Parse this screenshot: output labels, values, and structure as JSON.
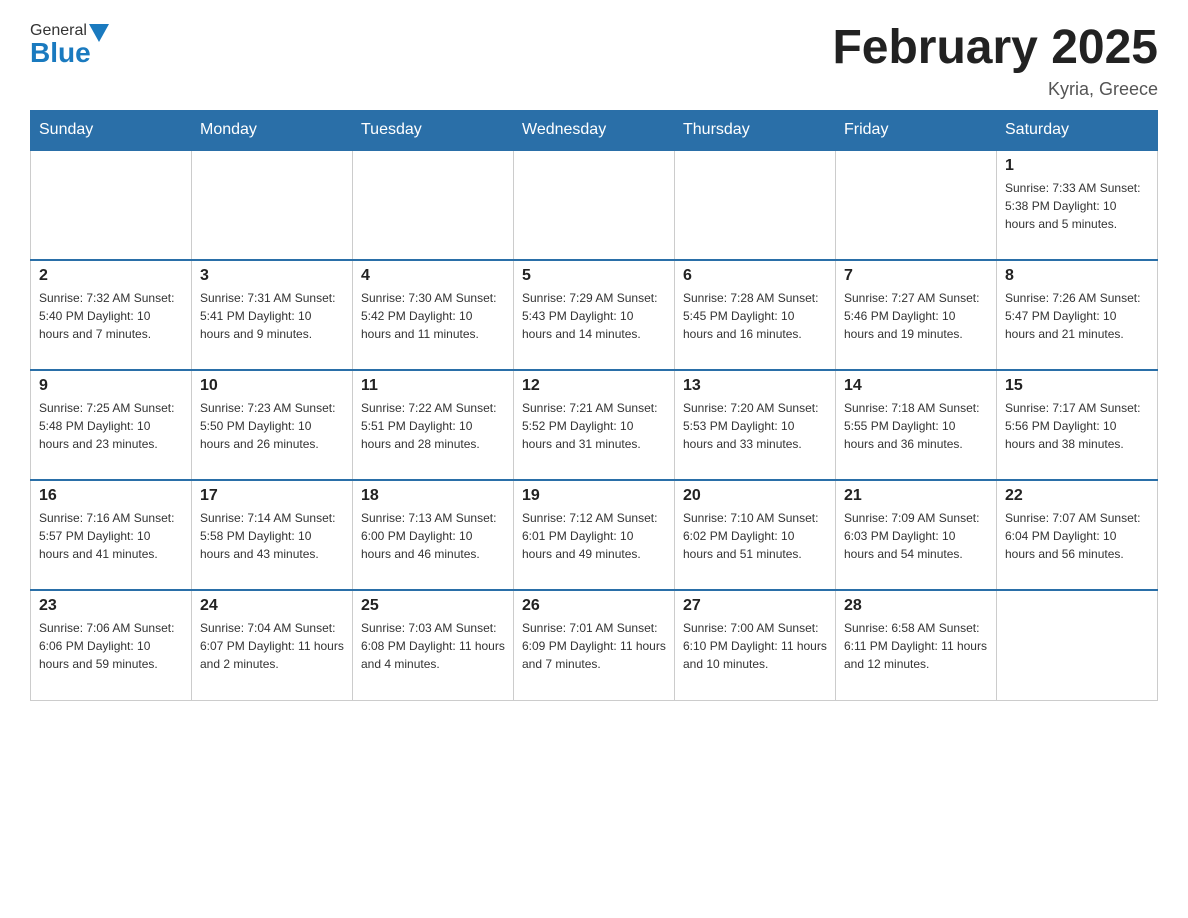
{
  "header": {
    "logo_general": "General",
    "logo_blue": "Blue",
    "month_title": "February 2025",
    "location": "Kyria, Greece"
  },
  "weekdays": [
    "Sunday",
    "Monday",
    "Tuesday",
    "Wednesday",
    "Thursday",
    "Friday",
    "Saturday"
  ],
  "weeks": [
    [
      {
        "day": "",
        "info": ""
      },
      {
        "day": "",
        "info": ""
      },
      {
        "day": "",
        "info": ""
      },
      {
        "day": "",
        "info": ""
      },
      {
        "day": "",
        "info": ""
      },
      {
        "day": "",
        "info": ""
      },
      {
        "day": "1",
        "info": "Sunrise: 7:33 AM\nSunset: 5:38 PM\nDaylight: 10 hours and 5 minutes."
      }
    ],
    [
      {
        "day": "2",
        "info": "Sunrise: 7:32 AM\nSunset: 5:40 PM\nDaylight: 10 hours and 7 minutes."
      },
      {
        "day": "3",
        "info": "Sunrise: 7:31 AM\nSunset: 5:41 PM\nDaylight: 10 hours and 9 minutes."
      },
      {
        "day": "4",
        "info": "Sunrise: 7:30 AM\nSunset: 5:42 PM\nDaylight: 10 hours and 11 minutes."
      },
      {
        "day": "5",
        "info": "Sunrise: 7:29 AM\nSunset: 5:43 PM\nDaylight: 10 hours and 14 minutes."
      },
      {
        "day": "6",
        "info": "Sunrise: 7:28 AM\nSunset: 5:45 PM\nDaylight: 10 hours and 16 minutes."
      },
      {
        "day": "7",
        "info": "Sunrise: 7:27 AM\nSunset: 5:46 PM\nDaylight: 10 hours and 19 minutes."
      },
      {
        "day": "8",
        "info": "Sunrise: 7:26 AM\nSunset: 5:47 PM\nDaylight: 10 hours and 21 minutes."
      }
    ],
    [
      {
        "day": "9",
        "info": "Sunrise: 7:25 AM\nSunset: 5:48 PM\nDaylight: 10 hours and 23 minutes."
      },
      {
        "day": "10",
        "info": "Sunrise: 7:23 AM\nSunset: 5:50 PM\nDaylight: 10 hours and 26 minutes."
      },
      {
        "day": "11",
        "info": "Sunrise: 7:22 AM\nSunset: 5:51 PM\nDaylight: 10 hours and 28 minutes."
      },
      {
        "day": "12",
        "info": "Sunrise: 7:21 AM\nSunset: 5:52 PM\nDaylight: 10 hours and 31 minutes."
      },
      {
        "day": "13",
        "info": "Sunrise: 7:20 AM\nSunset: 5:53 PM\nDaylight: 10 hours and 33 minutes."
      },
      {
        "day": "14",
        "info": "Sunrise: 7:18 AM\nSunset: 5:55 PM\nDaylight: 10 hours and 36 minutes."
      },
      {
        "day": "15",
        "info": "Sunrise: 7:17 AM\nSunset: 5:56 PM\nDaylight: 10 hours and 38 minutes."
      }
    ],
    [
      {
        "day": "16",
        "info": "Sunrise: 7:16 AM\nSunset: 5:57 PM\nDaylight: 10 hours and 41 minutes."
      },
      {
        "day": "17",
        "info": "Sunrise: 7:14 AM\nSunset: 5:58 PM\nDaylight: 10 hours and 43 minutes."
      },
      {
        "day": "18",
        "info": "Sunrise: 7:13 AM\nSunset: 6:00 PM\nDaylight: 10 hours and 46 minutes."
      },
      {
        "day": "19",
        "info": "Sunrise: 7:12 AM\nSunset: 6:01 PM\nDaylight: 10 hours and 49 minutes."
      },
      {
        "day": "20",
        "info": "Sunrise: 7:10 AM\nSunset: 6:02 PM\nDaylight: 10 hours and 51 minutes."
      },
      {
        "day": "21",
        "info": "Sunrise: 7:09 AM\nSunset: 6:03 PM\nDaylight: 10 hours and 54 minutes."
      },
      {
        "day": "22",
        "info": "Sunrise: 7:07 AM\nSunset: 6:04 PM\nDaylight: 10 hours and 56 minutes."
      }
    ],
    [
      {
        "day": "23",
        "info": "Sunrise: 7:06 AM\nSunset: 6:06 PM\nDaylight: 10 hours and 59 minutes."
      },
      {
        "day": "24",
        "info": "Sunrise: 7:04 AM\nSunset: 6:07 PM\nDaylight: 11 hours and 2 minutes."
      },
      {
        "day": "25",
        "info": "Sunrise: 7:03 AM\nSunset: 6:08 PM\nDaylight: 11 hours and 4 minutes."
      },
      {
        "day": "26",
        "info": "Sunrise: 7:01 AM\nSunset: 6:09 PM\nDaylight: 11 hours and 7 minutes."
      },
      {
        "day": "27",
        "info": "Sunrise: 7:00 AM\nSunset: 6:10 PM\nDaylight: 11 hours and 10 minutes."
      },
      {
        "day": "28",
        "info": "Sunrise: 6:58 AM\nSunset: 6:11 PM\nDaylight: 11 hours and 12 minutes."
      },
      {
        "day": "",
        "info": ""
      }
    ]
  ]
}
